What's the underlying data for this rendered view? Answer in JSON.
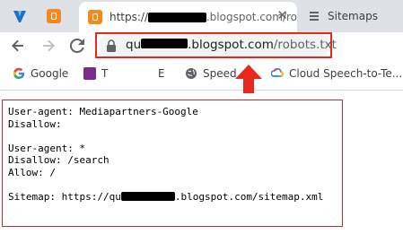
{
  "tabs": [
    {
      "name": "pinned-app-v",
      "label": ""
    },
    {
      "name": "pinned-blogger",
      "label": ""
    },
    {
      "name": "active",
      "label_prefix": "https://",
      "label_suffix": ".blogspot.com/ro"
    },
    {
      "name": "sitemaps",
      "label": "Sitemaps"
    }
  ],
  "address_bar": {
    "host_prefix": "qu",
    "host_suffix": ".blogspot.com",
    "path": "/robots.txt"
  },
  "bookmarks": [
    {
      "label": "Google",
      "icon": "google-g-icon"
    },
    {
      "label": "T",
      "icon": "bookmark-purple-icon"
    },
    {
      "label": "E",
      "icon": "blank-page-icon"
    },
    {
      "label": "Speed",
      "icon": "globe-icon"
    },
    {
      "label": "Cloud Speech-to-Te...",
      "icon": "google-cloud-icon"
    }
  ],
  "robots_lines": [
    "User-agent: Mediapartners-Google",
    "Disallow:",
    "",
    "User-agent: *",
    "Disallow: /search",
    "Allow: /",
    "",
    "Sitemap: https://qu",
    ".blogspot.com/sitemap.xml"
  ],
  "colors": {
    "tabstrip": "#dee1e6",
    "annotation_red": "#e8271f",
    "blogger_orange": "#f4891f"
  }
}
